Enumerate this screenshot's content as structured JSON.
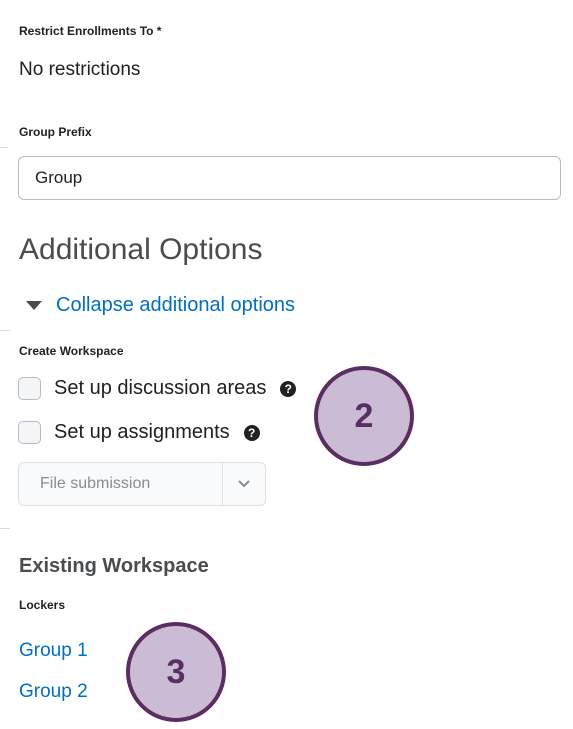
{
  "restrict_enrollments": {
    "label": "Restrict Enrollments To *",
    "value": "No restrictions"
  },
  "group_prefix": {
    "label": "Group Prefix",
    "value": "Group"
  },
  "additional_options": {
    "heading": "Additional Options",
    "toggle_label": "Collapse additional options",
    "toggle_icon": "triangle-down-icon"
  },
  "create_workspace": {
    "label": "Create Workspace",
    "options": [
      {
        "label": "Set up discussion areas",
        "checked": false,
        "help_icon": "question-circle-icon"
      },
      {
        "label": "Set up assignments",
        "checked": false,
        "help_icon": "question-circle-icon"
      }
    ],
    "submission_select": {
      "value": "File submission",
      "icon": "chevron-down-icon"
    }
  },
  "existing_workspace": {
    "heading": "Existing Workspace",
    "lockers_label": "Lockers",
    "lockers": [
      "Group 1",
      "Group 2"
    ]
  },
  "callouts": [
    "2",
    "3"
  ],
  "colors": {
    "link": "#006fbf",
    "callout_fill": "#cbbcd6",
    "callout_border": "#5a2e63"
  }
}
